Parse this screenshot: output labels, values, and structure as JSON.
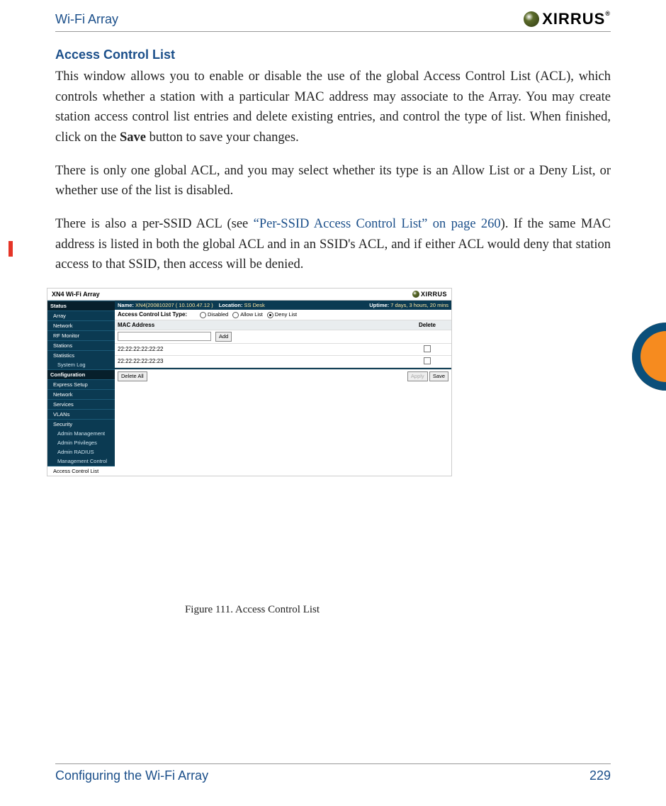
{
  "header": {
    "title": "Wi-Fi Array",
    "brand": "XIRRUS"
  },
  "section_heading": "Access Control List",
  "para1_a": "This window allows you to enable or disable the use of the global Access Control List (ACL), which controls whether a station with a particular MAC address may associate to the Array. You may create station access control list entries and delete existing entries, and control the type of list. When finished, click on the ",
  "para1_b": "Save",
  "para1_c": " button to save your changes.",
  "para2": "There is only one global ACL, and you may select whether its type is an Allow List or a Deny List, or whether use of the list is disabled.",
  "para3_a": "There is also a per-SSID ACL (see ",
  "para3_link": "“Per-SSID Access Control List” on page 260",
  "para3_b": "). If the same MAC address is listed in both the global ACL and in an SSID's ACL, and if either ACL would deny that station access to that SSID, then access will be denied.",
  "figure": {
    "title": "XN4 Wi-Fi Array",
    "brand": "XIRRUS",
    "infobar": {
      "name_label": "Name:",
      "name_value": "XN4(200810207  ( 10.100.47.12 )",
      "loc_label": "Location:",
      "loc_value": "SS Desk",
      "uptime_label": "Uptime:",
      "uptime_value": "7 days, 3 hours, 20 mins"
    },
    "sidebar": {
      "status": "Status",
      "array": "Array",
      "network": "Network",
      "rf": "RF Monitor",
      "stations": "Stations",
      "stats": "Statistics",
      "syslog": "System Log",
      "config": "Configuration",
      "express": "Express Setup",
      "net2": "Network",
      "services": "Services",
      "vlans": "VLANs",
      "security": "Security",
      "admin_mgmt": "Admin Management",
      "admin_priv": "Admin Privileges",
      "admin_radius": "Admin RADIUS",
      "mgmt_ctrl": "Management Control",
      "acl": "Access Control List"
    },
    "acl_type_label": "Access Control List Type:",
    "radio_disabled": "Disabled",
    "radio_allow": "Allow List",
    "radio_deny": "Deny List",
    "col_mac": "MAC Address",
    "col_delete": "Delete",
    "add_btn": "Add",
    "rows": {
      "r1": "22:22:22:22:22:22",
      "r2": "22:22:22:22:22:23"
    },
    "delete_all": "Delete All",
    "apply": "Apply",
    "save": "Save"
  },
  "figure_caption": "Figure 111. Access Control List",
  "footer": {
    "section": "Configuring the Wi-Fi Array",
    "page": "229"
  }
}
